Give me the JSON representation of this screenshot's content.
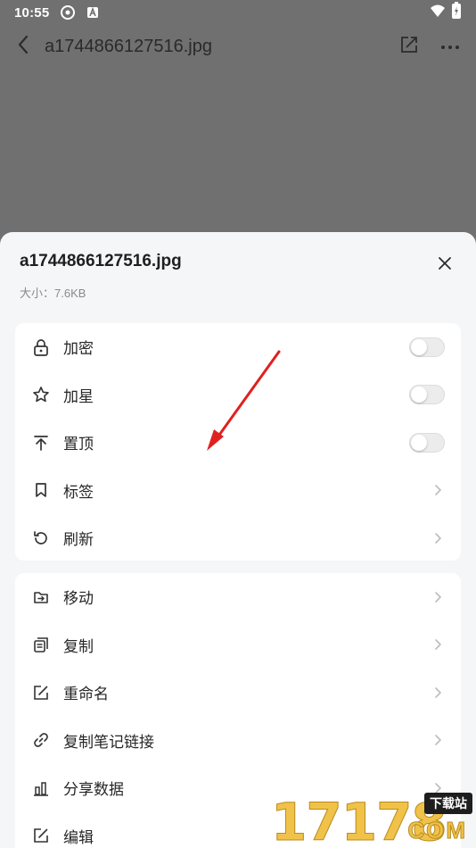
{
  "status_bar": {
    "time": "10:55"
  },
  "app_bar": {
    "title": "a1744866127516.jpg"
  },
  "sheet": {
    "title": "a1744866127516.jpg",
    "size_text": "大小：7.6KB"
  },
  "group1": [
    {
      "label": "加密",
      "icon": "lock-icon",
      "control": "toggle",
      "on": false
    },
    {
      "label": "加星",
      "icon": "star-icon",
      "control": "toggle",
      "on": false
    },
    {
      "label": "置顶",
      "icon": "pin-top-icon",
      "control": "toggle",
      "on": false
    },
    {
      "label": "标签",
      "icon": "bookmark-icon",
      "control": "chevron"
    },
    {
      "label": "刷新",
      "icon": "refresh-icon",
      "control": "chevron"
    }
  ],
  "group2": [
    {
      "label": "移动",
      "icon": "move-icon",
      "control": "chevron"
    },
    {
      "label": "复制",
      "icon": "copy-icon",
      "control": "chevron"
    },
    {
      "label": "重命名",
      "icon": "rename-icon",
      "control": "chevron"
    },
    {
      "label": "复制笔记链接",
      "icon": "link-icon",
      "control": "chevron"
    },
    {
      "label": "分享数据",
      "icon": "bar-chart-icon",
      "control": "chevron"
    },
    {
      "label": "编辑",
      "icon": "edit-icon",
      "control": "chevron"
    }
  ],
  "watermark": {
    "digits": "17178",
    "badge": "下载站",
    "com": "COM"
  },
  "colors": {
    "accent_arrow": "#e02020",
    "sheet_bg": "#f5f6f8",
    "dim_bg": "#707070"
  }
}
